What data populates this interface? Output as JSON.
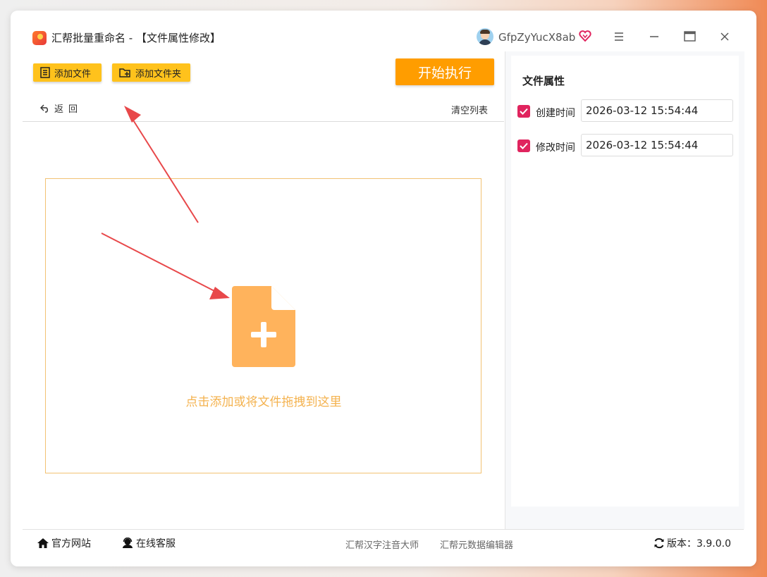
{
  "window": {
    "title": "汇帮批量重命名 - 【文件属性修改】",
    "username": "GfpZyYucX8ab"
  },
  "toolbar": {
    "add_file": "添加文件",
    "add_folder": "添加文件夹",
    "start": "开始执行",
    "back": "返回",
    "clear": "清空列表"
  },
  "dropzone": {
    "hint": "点击添加或将文件拖拽到这里"
  },
  "panel": {
    "title": "文件属性",
    "properties": [
      {
        "label": "创建时间",
        "checked": true,
        "value": "2026-03-12 15:54:44"
      },
      {
        "label": "修改时间",
        "checked": true,
        "value": "2026-03-12 15:54:44"
      }
    ]
  },
  "footer": {
    "website": "官方网站",
    "support": "在线客服",
    "link1": "汇帮汉字注音大师",
    "link2": "汇帮元数据编辑器",
    "version": "版本：3.9.0.0"
  },
  "colors": {
    "accent_yellow": "#ffc21c",
    "start_orange": "#ff9d00",
    "drop_icon": "#ffb35c",
    "checkbox": "#e0245e",
    "annotation_arrow": "#e8484a"
  },
  "icons": [
    "app-logo-icon",
    "user-avatar",
    "vip-heart-icon",
    "menu-icon",
    "minimize-icon",
    "maximize-icon",
    "close-icon",
    "add-file-icon",
    "add-folder-icon",
    "back-arrow-icon",
    "file-add-icon",
    "home-icon",
    "support-icon",
    "refresh-icon"
  ]
}
